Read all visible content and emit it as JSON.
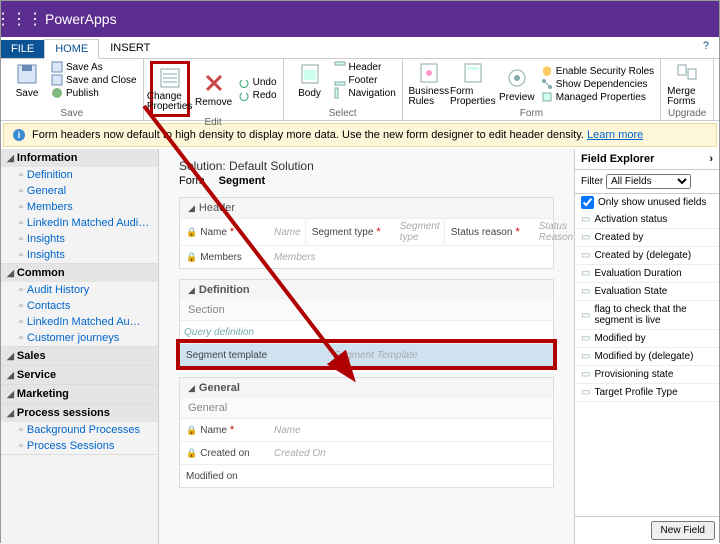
{
  "header": {
    "app_title": "PowerApps"
  },
  "tabs": {
    "file": "FILE",
    "home": "HOME",
    "insert": "INSERT"
  },
  "ribbon": {
    "save": {
      "label": "Save",
      "save_as": "Save As",
      "save_close": "Save and Close",
      "publish": "Publish",
      "group": "Save"
    },
    "edit": {
      "change_props": "Change Properties",
      "remove": "Remove",
      "undo": "Undo",
      "redo": "Redo",
      "group": "Edit"
    },
    "select": {
      "body": "Body",
      "header": "Header",
      "footer": "Footer",
      "nav": "Navigation",
      "group": "Select"
    },
    "form": {
      "br": "Business Rules",
      "fp": "Form Properties",
      "preview": "Preview",
      "sec": "Enable Security Roles",
      "dep": "Show Dependencies",
      "mp": "Managed Properties",
      "group": "Form"
    },
    "upgrade": {
      "merge": "Merge Forms",
      "group": "Upgrade"
    }
  },
  "infoBar": {
    "text": "Form headers now default to high density to display more data. Use the new form designer to edit header density. ",
    "link": "Learn more"
  },
  "sidebar": {
    "information": {
      "title": "Information",
      "items": [
        "Definition",
        "General",
        "Members",
        "LinkedIn Matched Audi…",
        "Insights",
        "Insights"
      ]
    },
    "common": {
      "title": "Common",
      "items": [
        "Audit History",
        "Contacts",
        "LinkedIn Matched Au…",
        "Customer journeys"
      ]
    },
    "sales": {
      "title": "Sales"
    },
    "service": {
      "title": "Service"
    },
    "marketing": {
      "title": "Marketing"
    },
    "process": {
      "title": "Process sessions",
      "items": [
        "Background Processes",
        "Process Sessions"
      ]
    }
  },
  "center": {
    "solution": "Solution: Default Solution",
    "form_label": "Form",
    "form_name": "Segment",
    "header_sec": "Header",
    "name": "Name",
    "name_ph": "Name",
    "seg_type": "Segment type",
    "seg_type_ph": "Segment type",
    "status": "Status reason",
    "status_ph": "Status Reason",
    "members": "Members",
    "members_ph": "Members",
    "def": "Definition",
    "section": "Section",
    "query_def": "Query definition",
    "seg_tmpl": "Segment template",
    "seg_tmpl_ph": "Segment Template",
    "general": "General",
    "general2": "General",
    "created_on": "Created on",
    "created_on_ph": "Created On",
    "modified_on": "Modified on"
  },
  "fieldExplorer": {
    "title": "Field Explorer",
    "filter_label": "Filter",
    "filter_value": "All Fields",
    "only_unused": "Only show unused fields",
    "items": [
      "Activation status",
      "Created by",
      "Created by (delegate)",
      "Evaluation Duration",
      "Evaluation State",
      "flag to check that the segment is live",
      "Modified by",
      "Modified by (delegate)",
      "Provisioning state",
      "Target Profile Type"
    ],
    "new_field": "New Field"
  }
}
